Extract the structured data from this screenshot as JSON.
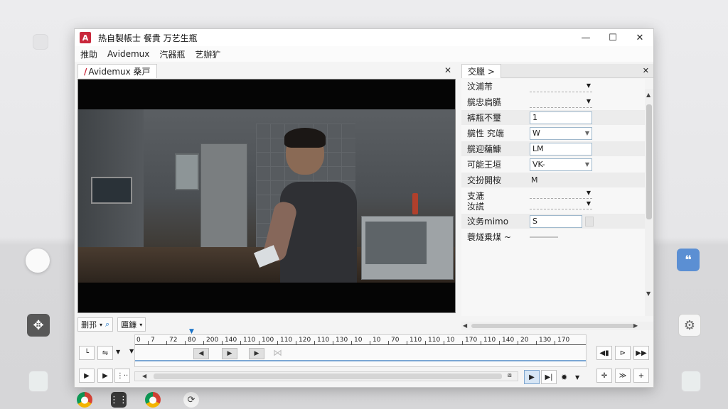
{
  "window": {
    "app_logo": "A",
    "title": "热自製帳士 餐貴 万艺生瓶",
    "controls": {
      "minimize": "—",
      "maximize": "☐",
      "close": "✕"
    }
  },
  "menubar": [
    "推助",
    "Avidemux",
    "汽器瓶",
    "艺辦犷"
  ],
  "video_panel": {
    "tab_label": "Avidemux 桑戸",
    "close": "✕"
  },
  "properties_panel": {
    "tab_label": "交臘 >",
    "close": "✕",
    "rows": [
      {
        "label": "汶浦芾",
        "kind": "dropdown"
      },
      {
        "label": "艞忠扃臙",
        "kind": "dropdown"
      },
      {
        "label": "裤瓶不璽",
        "kind": "input",
        "value": "1"
      },
      {
        "label": "艞性 究端",
        "kind": "input-dd",
        "value": "W"
      },
      {
        "label": "艞迎藊鱇",
        "kind": "input",
        "value": "LM"
      },
      {
        "label": "可能王垣",
        "kind": "input-dd",
        "value": "VK-"
      },
      {
        "label": "交扮開桉",
        "kind": "text",
        "value": "M"
      },
      {
        "label": "支漉",
        "label2": "汝謊",
        "kind": "dropdown2"
      },
      {
        "label": "汶务mimo",
        "kind": "input-btn",
        "value": "S"
      },
      {
        "label": "蓑燧乗煤 ~",
        "kind": "line"
      }
    ]
  },
  "control_strip": {
    "combo1": "删邘",
    "combo2": "匾鐮"
  },
  "timeline": {
    "start_marker": "0",
    "ticks": [
      "7",
      "72",
      "80",
      "200",
      "140",
      "110",
      "100",
      "110",
      "120",
      "110",
      "130",
      "10",
      "10",
      "70",
      "110",
      "110",
      "10",
      "170",
      "110",
      "140",
      "20",
      "130",
      "170"
    ]
  },
  "colors": {
    "accent": "#1a73c8",
    "brand": "#c9283c",
    "window_bg": "#f4f4f4"
  }
}
